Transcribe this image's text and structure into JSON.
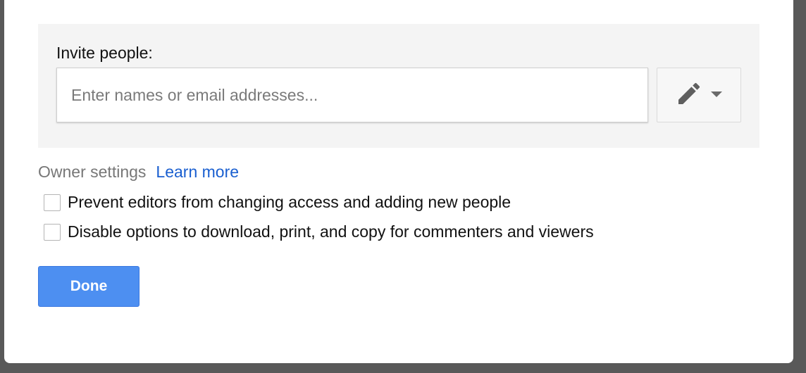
{
  "invite": {
    "label": "Invite people:",
    "placeholder": "Enter names or email addresses...",
    "value": "",
    "permission_icon": "pencil-icon",
    "dropdown_icon": "caret-down-icon"
  },
  "owner_settings": {
    "label": "Owner settings",
    "learn_more": "Learn more",
    "options": [
      {
        "label": "Prevent editors from changing access and adding new people",
        "checked": false
      },
      {
        "label": "Disable options to download, print, and copy for commenters and viewers",
        "checked": false
      }
    ]
  },
  "actions": {
    "done_label": "Done"
  },
  "colors": {
    "primary_button": "#4d8ff1",
    "link": "#1a5fd0",
    "panel_bg": "#f4f4f4"
  }
}
